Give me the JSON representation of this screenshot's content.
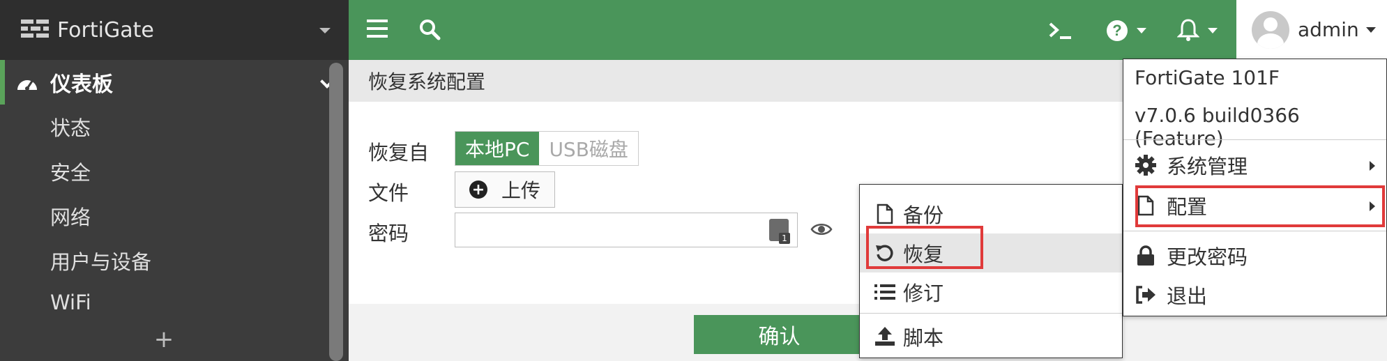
{
  "sidebar": {
    "brand": "FortiGate",
    "section": "仪表板",
    "items": [
      "状态",
      "安全",
      "网络",
      "用户与设备",
      "WiFi"
    ],
    "add_label": "+"
  },
  "topbar": {
    "user": "admin",
    "icons": [
      "menu-icon",
      "search-icon",
      "cli-console-icon",
      "help-icon",
      "notification-bell-icon"
    ]
  },
  "page": {
    "title": "恢复系统配置",
    "restore_from_label": "恢复自",
    "restore_options": [
      "本地PC",
      "USB磁盘"
    ],
    "file_label": "文件",
    "upload_label": "上传",
    "password_label": "密码",
    "password_value": "",
    "confirm_label": "确认"
  },
  "config_submenu": {
    "items": [
      {
        "label": "备份",
        "icon": "file-icon"
      },
      {
        "label": "恢复",
        "icon": "undo-icon"
      },
      {
        "label": "修订",
        "icon": "list-icon"
      },
      {
        "label": "脚本",
        "icon": "upload-icon"
      }
    ]
  },
  "admin_menu": {
    "model": "FortiGate 101F",
    "version": "v7.0.6 build0366 (Feature)",
    "items": [
      {
        "label": "系统管理",
        "icon": "gear-icon"
      },
      {
        "label": "配置",
        "icon": "file-icon"
      },
      {
        "label": "更改密码",
        "icon": "lock-icon"
      },
      {
        "label": "退出",
        "icon": "sign-out-icon"
      }
    ]
  },
  "colors": {
    "brand_green": "#4a955a",
    "sidebar_bg": "#3c3c3c",
    "highlight_red": "#e03a3a"
  }
}
